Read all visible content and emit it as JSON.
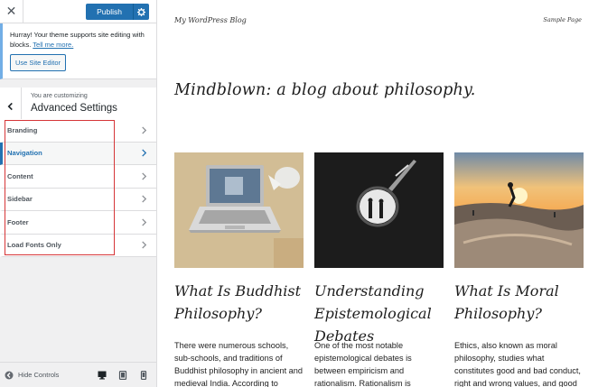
{
  "sidebar": {
    "close_icon": "close-icon",
    "publish_label": "Publish",
    "notice": {
      "text": "Hurray! Your theme supports site editing with blocks.",
      "link": "Tell me more.",
      "button": "Use Site Editor"
    },
    "customizing_label": "You are customizing",
    "section_title": "Advanced Settings",
    "items": [
      {
        "label": "Branding"
      },
      {
        "label": "Navigation"
      },
      {
        "label": "Content"
      },
      {
        "label": "Sidebar"
      },
      {
        "label": "Footer"
      },
      {
        "label": "Load Fonts Only"
      }
    ],
    "active_item": "Navigation",
    "hide_controls": "Hide Controls",
    "colors": {
      "accent": "#2271b1",
      "highlight": "#d63638"
    }
  },
  "preview": {
    "blog_name": "My WordPress Blog",
    "nav_link": "Sample Page",
    "heading": "Mindblown: a blog about philosophy.",
    "posts": [
      {
        "title": "What Is Buddhist Philosophy?",
        "excerpt": "There were numerous schools, sub-schools, and traditions of Buddhist philosophy in ancient and medieval India. According to"
      },
      {
        "title": "Understanding Epistemological Debates",
        "excerpt": "One of the most notable epistemological debates is between empiricism and rationalism. Rationalism is"
      },
      {
        "title": "What Is Moral Philosophy?",
        "excerpt": "Ethics, also known as moral philosophy, studies what constitutes good and bad conduct, right and wrong values, and good"
      }
    ]
  }
}
